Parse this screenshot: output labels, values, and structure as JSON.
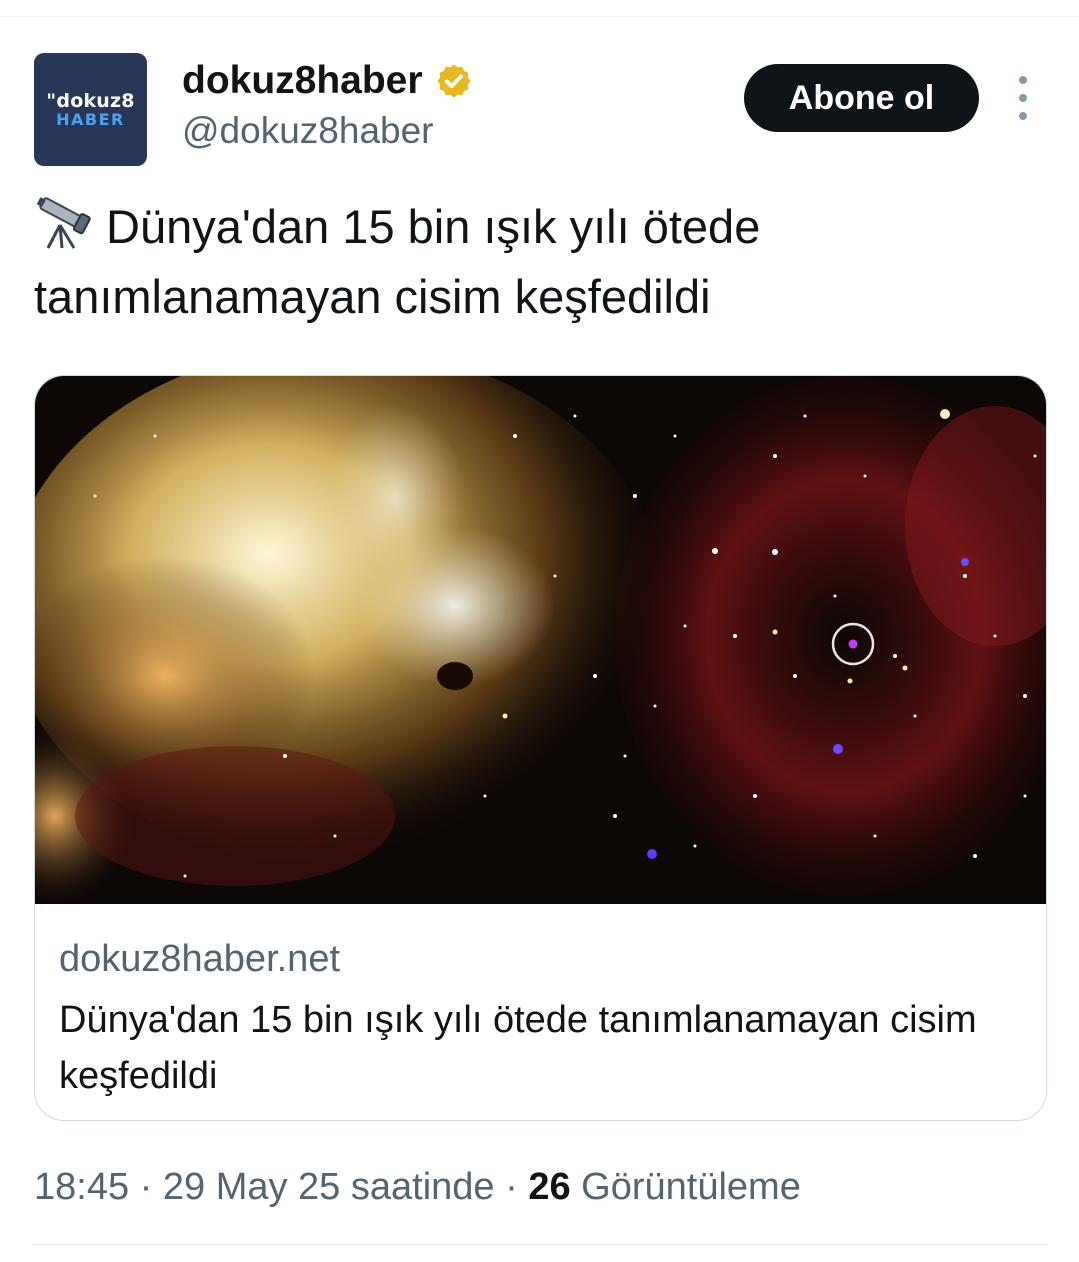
{
  "account": {
    "avatar_line1": "\"dokuz8",
    "avatar_line2": "HABER",
    "display_name": "dokuz8haber",
    "handle": "@dokuz8haber",
    "verified_color": "#e8b821"
  },
  "follow_button_label": "Abone ol",
  "tweet": {
    "emoji_icon": "telescope-icon",
    "text": "Dünya'dan 15 bin ışık yılı ötede tanımlanamayan cisim keşfedildi"
  },
  "link_card": {
    "domain": "dokuz8haber.net",
    "title": "Dünya'dan 15 bin ışık yılı ötede tanımlanamayan cisim keşfedildi"
  },
  "meta": {
    "time": "18:45",
    "separator": " · ",
    "date": "29 May 25 saatinde",
    "views_count": "26",
    "views_label": "Görüntüleme"
  }
}
